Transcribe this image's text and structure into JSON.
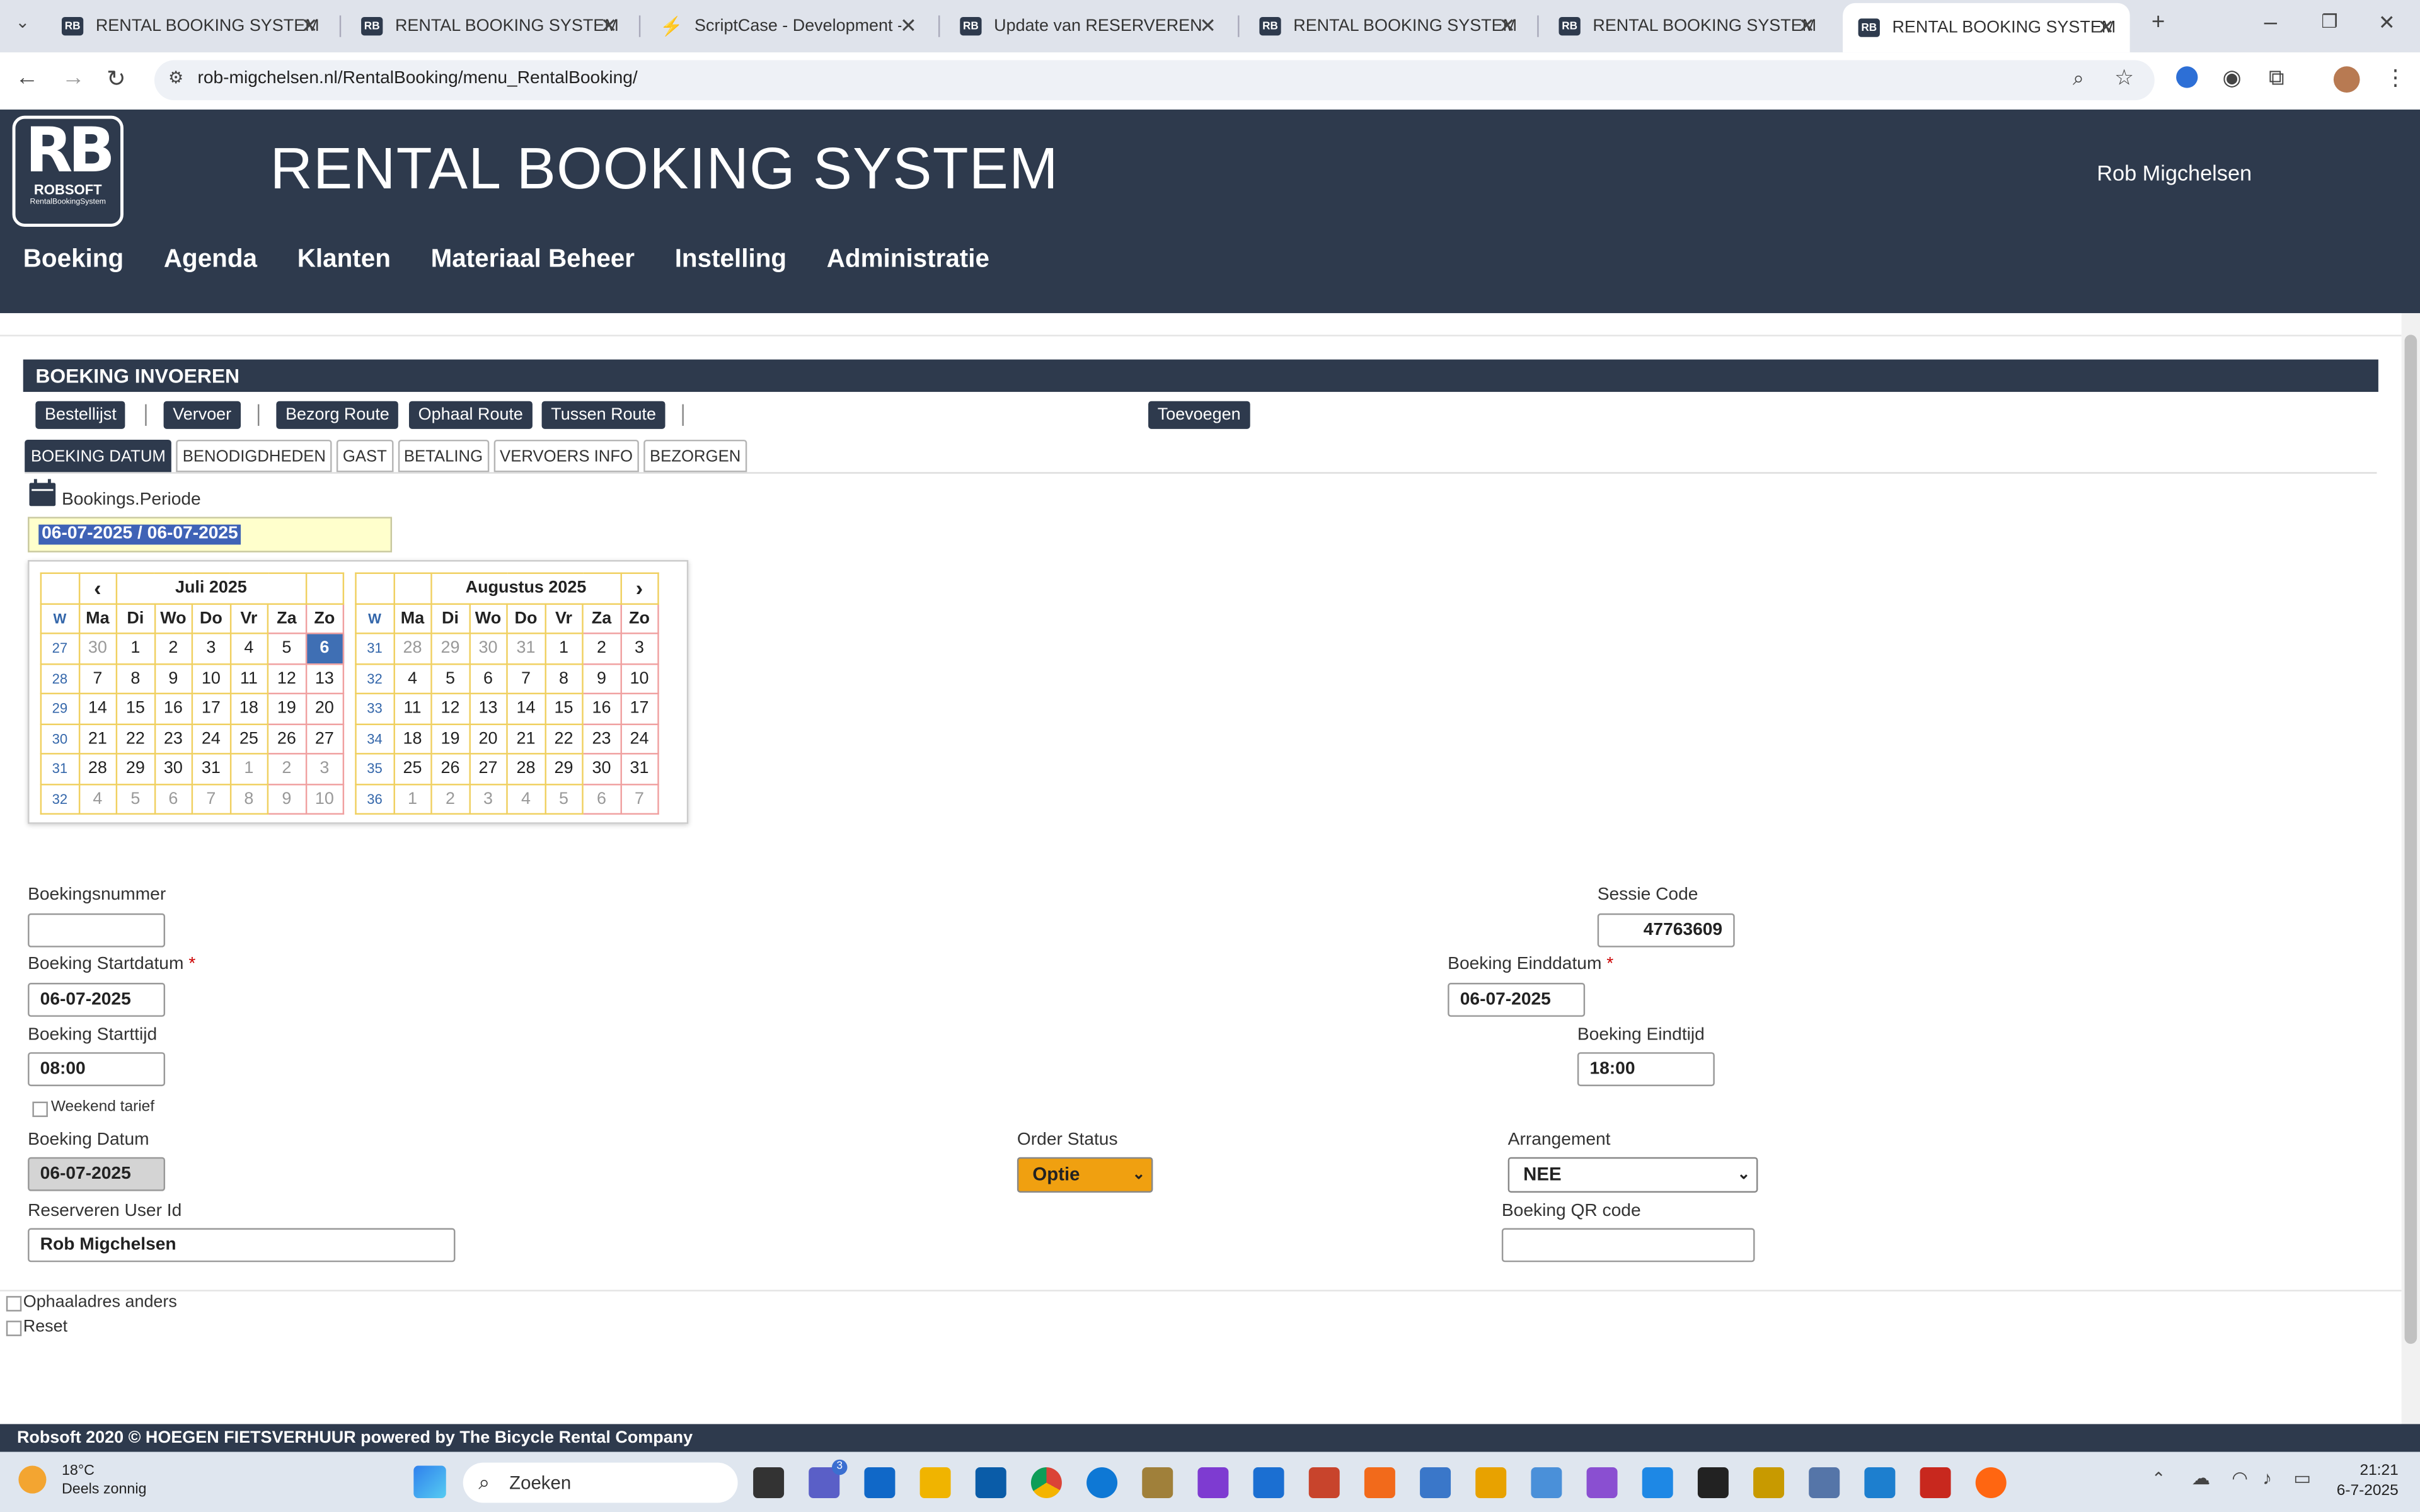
{
  "browser": {
    "tabs": [
      {
        "title": "RENTAL BOOKING SYSTEM",
        "active": false
      },
      {
        "title": "RENTAL BOOKING SYSTEM",
        "active": false
      },
      {
        "title": "ScriptCase - Development - rob",
        "active": false
      },
      {
        "title": "Update van RESERVEREN",
        "active": false
      },
      {
        "title": "RENTAL BOOKING SYSTEM",
        "active": false
      },
      {
        "title": "RENTAL BOOKING SYSTEM",
        "active": false
      },
      {
        "title": "RENTAL BOOKING SYSTEM",
        "active": true
      }
    ],
    "url": "rob-migchelsen.nl/RentalBooking/menu_RentalBooking/"
  },
  "header": {
    "logo_main": "RB",
    "logo_sub": "ROBSOFT",
    "logo_tiny": "RentalBookingSystem",
    "title": "RENTAL BOOKING SYSTEM",
    "user": "Rob Migchelsen",
    "nav": [
      "Boeking",
      "Agenda",
      "Klanten",
      "Materiaal Beheer",
      "Instelling",
      "Administratie"
    ]
  },
  "form": {
    "section_title": "BOEKING INVOEREN",
    "toolbar": {
      "bestellijst": "Bestellijst",
      "vervoer": "Vervoer",
      "bezorg_route": "Bezorg Route",
      "ophaal_route": "Ophaal Route",
      "tussen_route": "Tussen Route",
      "toevoegen": "Toevoegen"
    },
    "tabs": [
      "BOEKING DATUM",
      "BENODIGDHEDEN",
      "GAST",
      "BETALING",
      "VERVOERS INFO",
      "BEZORGEN"
    ],
    "period_label": "Bookings.Periode",
    "period_value": "06-07-2025 / 06-07-2025",
    "fields": {
      "boekingsnummer_label": "Boekingsnummer",
      "boekingsnummer_value": "",
      "sessie_label": "Sessie Code",
      "sessie_value": "47763609",
      "startdatum_label": "Boeking Startdatum",
      "startdatum_value": "06-07-2025",
      "einddatum_label": "Boeking Einddatum",
      "einddatum_value": "06-07-2025",
      "starttijd_label": "Boeking Starttijd",
      "starttijd_value": "08:00",
      "eindtijd_label": "Boeking Eindtijd",
      "eindtijd_value": "18:00",
      "weekend_label": "Weekend tarief",
      "boeking_datum_label": "Boeking Datum",
      "boeking_datum_value": "06-07-2025",
      "order_status_label": "Order Status",
      "order_status_value": "Optie",
      "arrangement_label": "Arrangement",
      "arrangement_value": "NEE",
      "user_id_label": "Reserveren User Id",
      "user_id_value": "Rob Migchelsen",
      "qr_label": "Boeking QR code",
      "qr_value": ""
    },
    "checks": {
      "ophaal": "Ophaaladres anders",
      "reset": "Reset"
    },
    "required_mark": "*"
  },
  "calendar": {
    "prev": "‹",
    "next": "›",
    "month1": "Juli 2025",
    "month2": "Augustus 2025",
    "week_header": "W",
    "day_headers": [
      "Ma",
      "Di",
      "Wo",
      "Do",
      "Vr",
      "Za",
      "Zo"
    ],
    "month1_rows": [
      {
        "w": "27",
        "days": [
          "30",
          "1",
          "2",
          "3",
          "4",
          "5",
          "6"
        ]
      },
      {
        "w": "28",
        "days": [
          "7",
          "8",
          "9",
          "10",
          "11",
          "12",
          "13"
        ]
      },
      {
        "w": "29",
        "days": [
          "14",
          "15",
          "16",
          "17",
          "18",
          "19",
          "20"
        ]
      },
      {
        "w": "30",
        "days": [
          "21",
          "22",
          "23",
          "24",
          "25",
          "26",
          "27"
        ]
      },
      {
        "w": "31",
        "days": [
          "28",
          "29",
          "30",
          "31",
          "1",
          "2",
          "3"
        ]
      },
      {
        "w": "32",
        "days": [
          "4",
          "5",
          "6",
          "7",
          "8",
          "9",
          "10"
        ]
      }
    ],
    "month2_rows": [
      {
        "w": "31",
        "days": [
          "28",
          "29",
          "30",
          "31",
          "1",
          "2",
          "3"
        ]
      },
      {
        "w": "32",
        "days": [
          "4",
          "5",
          "6",
          "7",
          "8",
          "9",
          "10"
        ]
      },
      {
        "w": "33",
        "days": [
          "11",
          "12",
          "13",
          "14",
          "15",
          "16",
          "17"
        ]
      },
      {
        "w": "34",
        "days": [
          "18",
          "19",
          "20",
          "21",
          "22",
          "23",
          "24"
        ]
      },
      {
        "w": "35",
        "days": [
          "25",
          "26",
          "27",
          "28",
          "29",
          "30",
          "31"
        ]
      },
      {
        "w": "36",
        "days": [
          "1",
          "2",
          "3",
          "4",
          "5",
          "6",
          "7"
        ]
      }
    ]
  },
  "footer": "Robsoft 2020 © HOEGEN FIETSVERHUUR powered by The Bicycle Rental Company",
  "taskbar": {
    "temp": "18°C",
    "weather": "Deels zonnig",
    "search": "Zoeken",
    "time": "21:21",
    "date": "6-7-2025",
    "badge": "3"
  },
  "colors": {
    "header_bg": "#2e3a4d",
    "order_status_bg": "#f0a010",
    "selected_day": "#3f6fb4"
  }
}
